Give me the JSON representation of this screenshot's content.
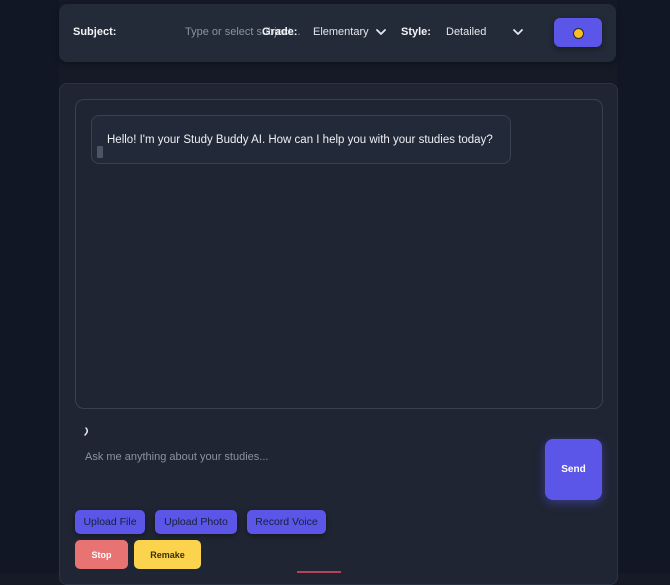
{
  "settings": {
    "subject_label": "Subject:",
    "subject_placeholder": "Type or select subject...",
    "grade_label": "Grade:",
    "grade_value": "Elementary",
    "style_label": "Style:",
    "style_value": "Detailed",
    "theme_icon": "sun-icon",
    "accent_color": "#5b55e8"
  },
  "chat": {
    "messages": [
      {
        "sender": "bot",
        "text": "Hello! I'm your Study Buddy AI. How can I help you with your studies today?"
      }
    ],
    "input_placeholder": "Ask me anything about your studies...",
    "send_label": "Send"
  },
  "actions": {
    "upload_file": "Upload File",
    "upload_photo": "Upload Photo",
    "record_voice": "Record Voice",
    "stop": "Stop",
    "remake": "Remake"
  }
}
